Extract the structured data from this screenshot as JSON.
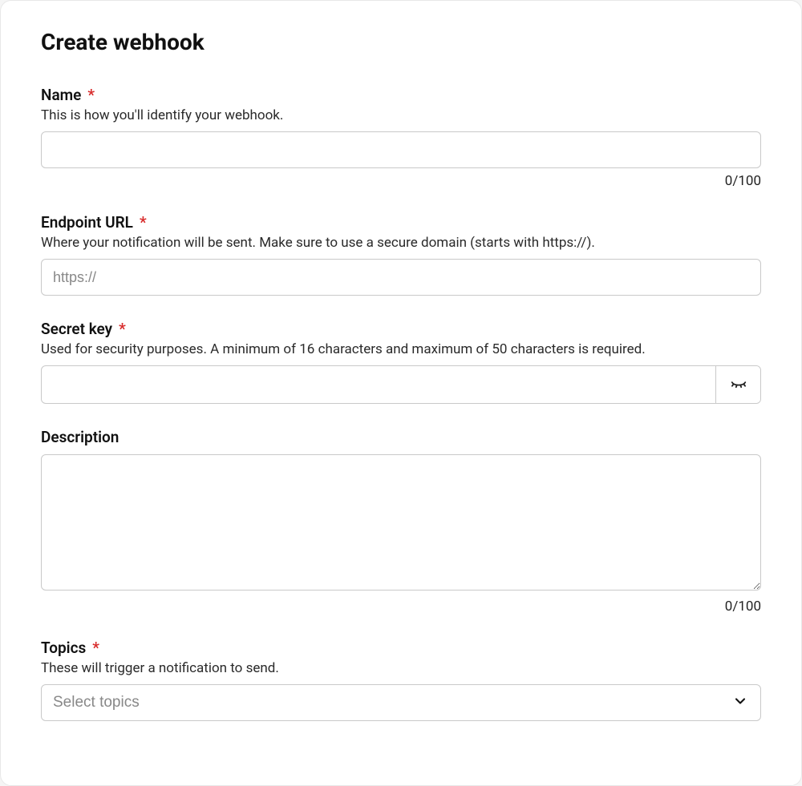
{
  "header": {
    "title": "Create webhook"
  },
  "form": {
    "name": {
      "label": "Name",
      "required": true,
      "help": "This is how you'll identify your webhook.",
      "value": "",
      "counter": "0/100",
      "maxlength": "100"
    },
    "endpoint": {
      "label": "Endpoint URL",
      "required": true,
      "help": "Where your notification will be sent. Make sure to use a secure domain (starts with https://).",
      "placeholder": "https://",
      "value": ""
    },
    "secret": {
      "label": "Secret key",
      "required": true,
      "help": "Used for security purposes. A minimum of 16 characters and maximum of 50 characters is required.",
      "value": ""
    },
    "description": {
      "label": "Description",
      "required": false,
      "value": "",
      "counter": "0/100",
      "maxlength": "100"
    },
    "topics": {
      "label": "Topics",
      "required": true,
      "help": "These will trigger a notification to send.",
      "placeholder": "Select topics"
    }
  },
  "required_marker": "*"
}
